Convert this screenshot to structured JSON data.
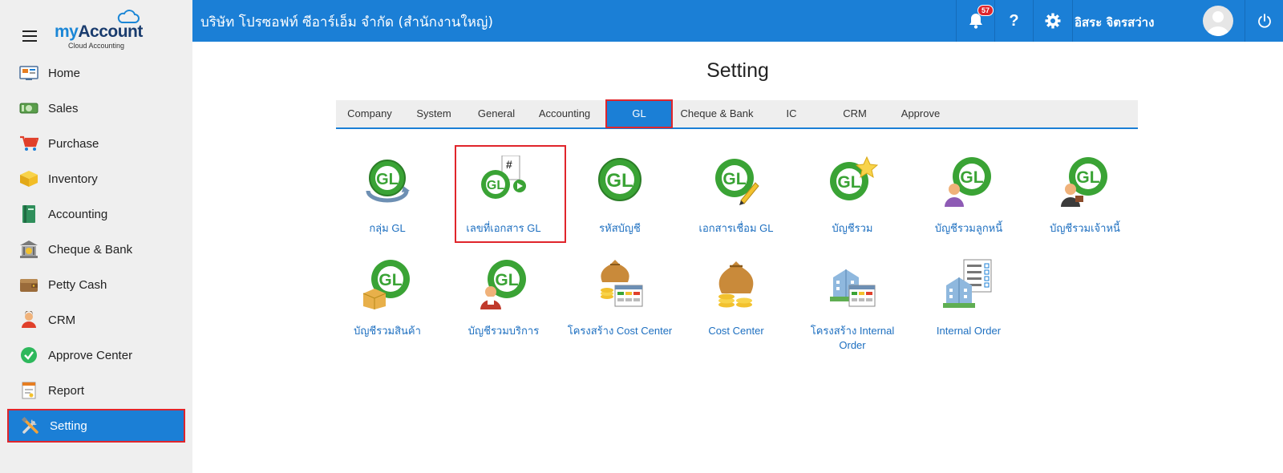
{
  "brand": {
    "logo_my": "my",
    "logo_account": "Account",
    "logo_sub": "Cloud Accounting"
  },
  "sidebar": {
    "items": [
      {
        "label": "Home",
        "icon": "home-icon"
      },
      {
        "label": "Sales",
        "icon": "money-icon"
      },
      {
        "label": "Purchase",
        "icon": "cart-icon"
      },
      {
        "label": "Inventory",
        "icon": "box-icon"
      },
      {
        "label": "Accounting",
        "icon": "book-icon"
      },
      {
        "label": "Cheque & Bank",
        "icon": "bank-icon"
      },
      {
        "label": "Petty Cash",
        "icon": "wallet-icon"
      },
      {
        "label": "CRM",
        "icon": "people-icon"
      },
      {
        "label": "Approve Center",
        "icon": "check-icon"
      },
      {
        "label": "Report",
        "icon": "report-icon"
      },
      {
        "label": "Setting",
        "icon": "tools-icon"
      }
    ],
    "active_index": 10
  },
  "header": {
    "company": "บริษัท โปรซอฟท์ ซีอาร์เอ็ม จำกัด (สำนักงานใหญ่)",
    "notification_count": "57",
    "help_label": "?",
    "user_name": "อิสระ จิตรสว่าง"
  },
  "main": {
    "title": "Setting",
    "tabs": [
      "Company",
      "System",
      "General",
      "Accounting",
      "GL",
      "Cheque & Bank",
      "IC",
      "CRM",
      "Approve"
    ],
    "active_tab": "GL",
    "items": [
      {
        "label": "กลุ่ม GL",
        "icon": "gl-group-icon"
      },
      {
        "label": "เลขที่เอกสาร GL",
        "icon": "gl-document-number-icon"
      },
      {
        "label": "รหัสบัญชี",
        "icon": "gl-account-code-icon"
      },
      {
        "label": "เอกสารเชื่อม GL",
        "icon": "gl-link-document-icon"
      },
      {
        "label": "บัญชีรวม",
        "icon": "gl-control-account-icon"
      },
      {
        "label": "บัญชีรวมลูกหนี้",
        "icon": "gl-debtor-account-icon"
      },
      {
        "label": "บัญชีรวมเจ้าหนี้",
        "icon": "gl-creditor-account-icon"
      },
      {
        "label": "บัญชีรวมสินค้า",
        "icon": "gl-product-account-icon"
      },
      {
        "label": "บัญชีรวมบริการ",
        "icon": "gl-service-account-icon"
      },
      {
        "label": "โครงสร้าง Cost Center",
        "icon": "cost-center-structure-icon"
      },
      {
        "label": "Cost Center",
        "icon": "cost-center-icon"
      },
      {
        "label": "โครงสร้าง Internal Order",
        "icon": "internal-order-structure-icon"
      },
      {
        "label": "Internal Order",
        "icon": "internal-order-icon"
      }
    ],
    "selected_item": "เลขที่เอกสาร GL"
  },
  "colors": {
    "primary": "#1b7fd6",
    "highlight": "#e0252b",
    "link": "#1d6fc0",
    "gl_green": "#3aa335"
  }
}
